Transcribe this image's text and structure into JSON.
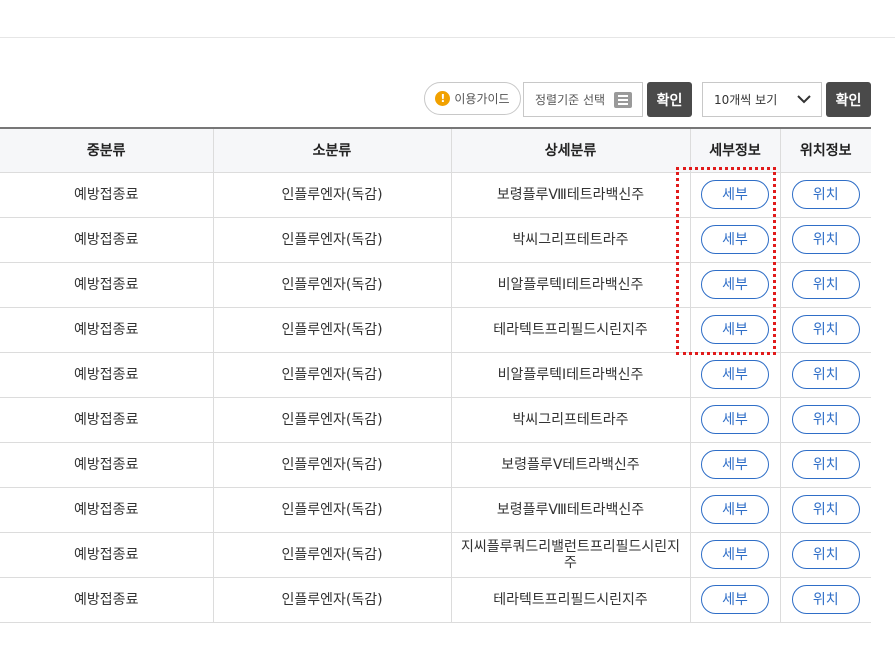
{
  "toolbar": {
    "guide_label": "이용가이드",
    "guide_icon": "warning-icon",
    "sort_placeholder": "정렬기준 선택",
    "confirm_label": "확인",
    "per_page_value": "10개씩 보기",
    "confirm2_label": "확인"
  },
  "table": {
    "headers": [
      "중분류",
      "소분류",
      "상세분류",
      "세부정보",
      "위치정보"
    ],
    "detail_button": "세부",
    "location_button": "위치",
    "rows": [
      {
        "mid": "예방접종료",
        "sub": "인플루엔자(독감)",
        "detail": "보령플루Ⅷ테트라백신주"
      },
      {
        "mid": "예방접종료",
        "sub": "인플루엔자(독감)",
        "detail": "박씨그리프테트라주"
      },
      {
        "mid": "예방접종료",
        "sub": "인플루엔자(독감)",
        "detail": "비알플루텍I테트라백신주"
      },
      {
        "mid": "예방접종료",
        "sub": "인플루엔자(독감)",
        "detail": "테라텍트프리필드시린지주"
      },
      {
        "mid": "예방접종료",
        "sub": "인플루엔자(독감)",
        "detail": "비알플루텍I테트라백신주"
      },
      {
        "mid": "예방접종료",
        "sub": "인플루엔자(독감)",
        "detail": "박씨그리프테트라주"
      },
      {
        "mid": "예방접종료",
        "sub": "인플루엔자(독감)",
        "detail": "보령플루Ⅴ테트라백신주"
      },
      {
        "mid": "예방접종료",
        "sub": "인플루엔자(독감)",
        "detail": "보령플루Ⅷ테트라백신주"
      },
      {
        "mid": "예방접종료",
        "sub": "인플루엔자(독감)",
        "detail": "지씨플루쿼드리밸런트프리필드시린지주"
      },
      {
        "mid": "예방접종료",
        "sub": "인플루엔자(독감)",
        "detail": "테라텍트프리필드시린지주"
      }
    ]
  },
  "colors": {
    "accent": "#2f6ec7",
    "dark_button": "#4a4a4a",
    "highlight": "#e11b1b",
    "warning": "#f1a100"
  }
}
